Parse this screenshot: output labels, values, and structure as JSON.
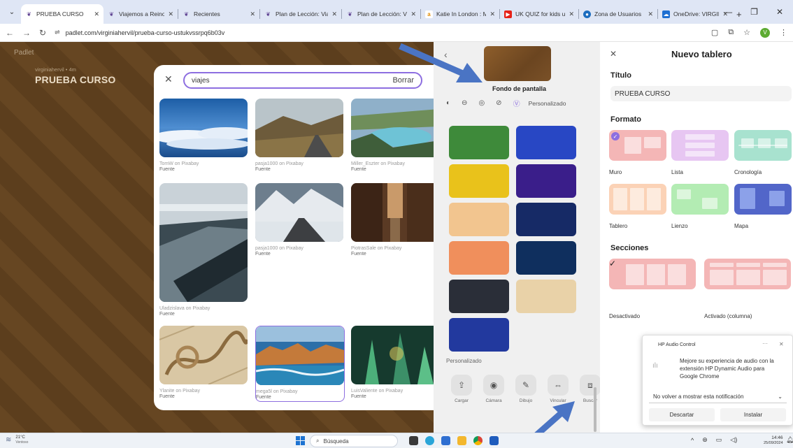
{
  "browser": {
    "tabs": [
      {
        "label": "PRUEBA CURSO",
        "icon": "padlet-icon",
        "active": true
      },
      {
        "label": "Viajemos a Reino Un",
        "icon": "padlet-icon",
        "active": false
      },
      {
        "label": "Recientes",
        "icon": "padlet-icon",
        "active": false
      },
      {
        "label": "Plan de Lección: Viaj",
        "icon": "padlet-icon",
        "active": false
      },
      {
        "label": "Plan de Lección: Viaj",
        "icon": "padlet-icon",
        "active": false
      },
      {
        "label": "Katie In London : Mo",
        "icon": "amazon-icon",
        "active": false
      },
      {
        "label": "UK QUIZ for kids uni",
        "icon": "youtube-icon",
        "active": false
      },
      {
        "label": "Zona de Usuarios",
        "icon": "zone-icon",
        "active": false
      },
      {
        "label": "OneDrive: VIRGINIA",
        "icon": "onedrive-icon",
        "active": false
      }
    ],
    "new_tab": "+",
    "url": "padlet.com/virginiahervil/prueba-curso-ustukvssrpq6b03v",
    "profile_initial": "V"
  },
  "board": {
    "logo": "Padlet",
    "author": "virginiahervil • 4m",
    "title": "PRUEBA CURSO"
  },
  "image_search": {
    "query": "viajes",
    "clear_label": "Borrar",
    "results": [
      {
        "credit": "TomW on Pixabay",
        "source": "Fuente",
        "theme": "clouds"
      },
      {
        "credit": "pasja1000 on Pixabay",
        "source": "Fuente",
        "theme": "road-desert"
      },
      {
        "credit": "Miller_Eszter on Pixabay",
        "source": "Fuente",
        "theme": "coast"
      },
      {
        "credit": "Uladzislava on Pixabay",
        "source": "Fuente",
        "theme": "beach"
      },
      {
        "credit": "pasja1000 on Pixabay",
        "source": "Fuente",
        "theme": "snow-road"
      },
      {
        "credit": "PiotrasSale on Pixabay",
        "source": "Fuente",
        "theme": "alley"
      },
      {
        "credit": "Ylanite on Pixabay",
        "source": "Fuente",
        "theme": "map-rope"
      },
      {
        "credit": "mega5l on Pixabay",
        "source": "Fuente",
        "theme": "cliffs"
      },
      {
        "credit": "LuisValiente on Pixabay",
        "source": "Fuente",
        "theme": "cave"
      }
    ]
  },
  "wallpaper": {
    "label": "Fondo de pantalla",
    "custom_tab": "Personalizado",
    "section": "Personalizado",
    "tools": [
      "Cargar",
      "Cámara",
      "Dibujo",
      "Vincular",
      "Buscar"
    ],
    "swatches": [
      {
        "color": "#3e8a3a"
      },
      {
        "color": "#2847c4"
      },
      {
        "color": "#e9c21b"
      },
      {
        "color": "#3a1e8a"
      },
      {
        "color": "#f2c58f"
      },
      {
        "color": "#162a66"
      },
      {
        "color": "#f08f5c"
      },
      {
        "color": "#0f2f5e"
      },
      {
        "color": "#2a2e38"
      },
      {
        "color": "#e9d2a8"
      },
      {
        "color": "#22399e"
      }
    ]
  },
  "settings": {
    "title": "Nuevo tablero",
    "title_label": "Título",
    "title_value": "PRUEBA CURSO",
    "format_label": "Formato",
    "formats": [
      {
        "name": "Muro",
        "color": "#f4b6b6",
        "selected": true
      },
      {
        "name": "Lista",
        "color": "#e7c6f2",
        "selected": false
      },
      {
        "name": "Cronología",
        "color": "#a8e2cf",
        "selected": false
      },
      {
        "name": "Tablero",
        "color": "#fbd2b6",
        "selected": false
      },
      {
        "name": "Lienzo",
        "color": "#b3ecb3",
        "selected": false
      },
      {
        "name": "Mapa",
        "color": "#5266c9",
        "selected": false
      }
    ],
    "sections_label": "Secciones",
    "sections": [
      {
        "name": "Desactivado",
        "selected": true
      },
      {
        "name": "Activado (columna)",
        "selected": false
      }
    ]
  },
  "notification": {
    "app": "HP Audio Control",
    "message": "Mejore su experiencia de audio con la extensión HP Dynamic Audio para Google Chrome",
    "dont_show": "No volver a mostrar esta notificación",
    "dismiss": "Descartar",
    "install": "Instalar"
  },
  "taskbar": {
    "temperature": "21°C",
    "weather": "Ventoso",
    "search_placeholder": "Búsqueda",
    "time": "14:46",
    "date": "25/09/2024"
  }
}
